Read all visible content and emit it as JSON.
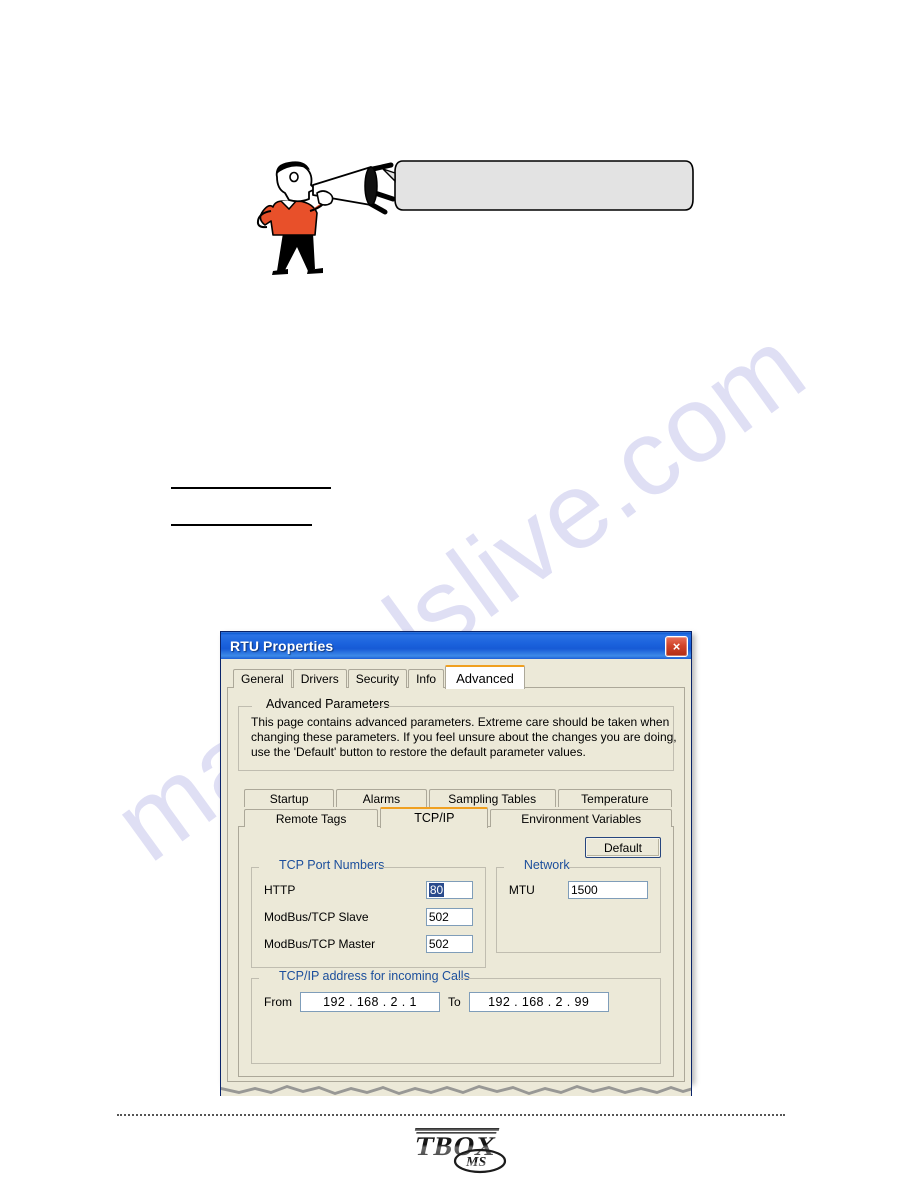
{
  "page": {
    "watermark": "manualslive.com"
  },
  "illustration": {
    "character": "man-with-megaphone",
    "speech_bubble_text": "",
    "shirt_color": "#e8502a"
  },
  "rules": [
    {
      "name": "horizontal-rule-upper"
    },
    {
      "name": "horizontal-rule-lower"
    }
  ],
  "dialog": {
    "title": "RTU Properties",
    "close_label": "×",
    "titlebar_color": "#1b63dd",
    "tabs": [
      {
        "label": "General",
        "selected": false
      },
      {
        "label": "Drivers",
        "selected": false
      },
      {
        "label": "Security",
        "selected": false
      },
      {
        "label": "Info",
        "selected": false
      },
      {
        "label": "Advanced",
        "selected": true
      }
    ],
    "advanced": {
      "group_title": "Advanced Parameters",
      "description_lines": [
        "This page contains advanced parameters. Extreme care should be taken when",
        "changing these parameters. If you feel unsure about the changes you are doing,",
        "use the 'Default' button to restore the default parameter values."
      ],
      "subtabs_row1": [
        {
          "label": "Startup",
          "selected": false
        },
        {
          "label": "Alarms",
          "selected": false
        },
        {
          "label": "Sampling Tables",
          "selected": false
        },
        {
          "label": "Temperature",
          "selected": false
        }
      ],
      "subtabs_row2": [
        {
          "label": "Remote Tags",
          "selected": false
        },
        {
          "label": "TCP/IP",
          "selected": true
        },
        {
          "label": "Environment Variables",
          "selected": false
        }
      ],
      "tcpip": {
        "default_button": "Default",
        "ports_group": {
          "title": "TCP Port Numbers",
          "title_color": "#1c4f9c",
          "fields": [
            {
              "label": "HTTP",
              "value": "80",
              "selected": true
            },
            {
              "label": "ModBus/TCP Slave",
              "value": "502",
              "selected": false
            },
            {
              "label": "ModBus/TCP Master",
              "value": "502",
              "selected": false
            }
          ]
        },
        "network_group": {
          "title": "Network",
          "title_color": "#1c4f9c",
          "fields": [
            {
              "label": "MTU",
              "value": "1500",
              "selected": false
            }
          ]
        },
        "incoming_group": {
          "title": "TCP/IP address for incoming Calls",
          "title_color": "#1c4f9c",
          "from_label": "From",
          "from_value": "192 . 168 .  2  .  1",
          "to_label": "To",
          "to_value": "192 . 168 .  2  .  99"
        }
      }
    }
  },
  "footer": {
    "logo_primary": "TBOX",
    "logo_secondary": "MS"
  }
}
